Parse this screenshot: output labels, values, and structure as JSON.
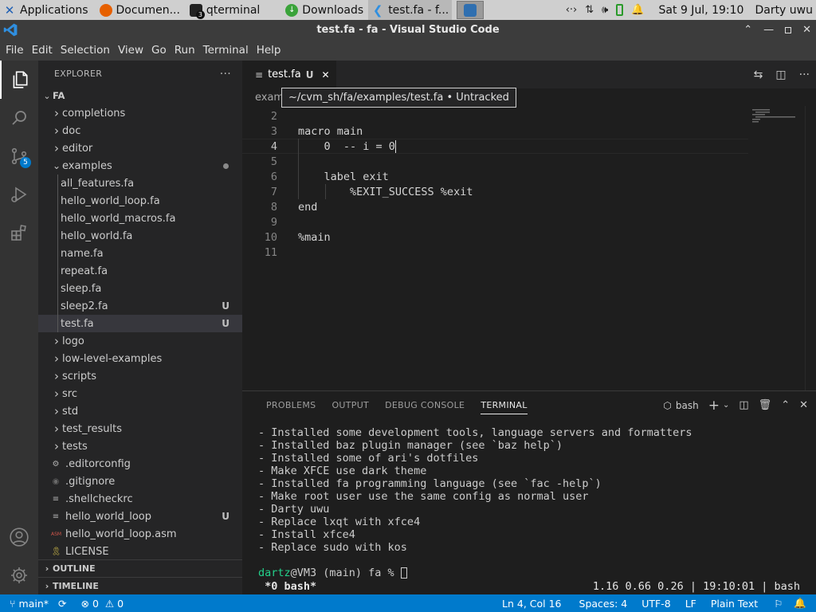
{
  "system_panel": {
    "tasks": [
      {
        "label": "Applications",
        "icon": "xfce-icon"
      },
      {
        "label": "Documen...",
        "icon": "firefox-icon"
      },
      {
        "label": "qterminal",
        "icon": "terminal-icon",
        "badge": "3"
      },
      {
        "label": "Downloads",
        "icon": "downloads-icon"
      },
      {
        "label": "test.fa - f...",
        "icon": "vscode-icon"
      }
    ],
    "clock": "Sat  9 Jul, 19:10",
    "user": "Darty uwu"
  },
  "window": {
    "title": "test.fa - fa - Visual Studio Code"
  },
  "menu": [
    "File",
    "Edit",
    "Selection",
    "View",
    "Go",
    "Run",
    "Terminal",
    "Help"
  ],
  "activity_bar": {
    "scm_badge": "5"
  },
  "explorer": {
    "header": "EXPLORER",
    "more": "···",
    "root": "FA",
    "items": [
      {
        "label": "completions",
        "kind": "folder",
        "indent": 1,
        "open": false
      },
      {
        "label": "doc",
        "kind": "folder",
        "indent": 1,
        "open": false
      },
      {
        "label": "editor",
        "kind": "folder",
        "indent": 1,
        "open": false
      },
      {
        "label": "examples",
        "kind": "folder",
        "indent": 1,
        "open": true,
        "dot": true
      },
      {
        "label": "all_features.fa",
        "kind": "file",
        "indent": 2
      },
      {
        "label": "hello_world_loop.fa",
        "kind": "file",
        "indent": 2
      },
      {
        "label": "hello_world_macros.fa",
        "kind": "file",
        "indent": 2
      },
      {
        "label": "hello_world.fa",
        "kind": "file",
        "indent": 2
      },
      {
        "label": "name.fa",
        "kind": "file",
        "indent": 2
      },
      {
        "label": "repeat.fa",
        "kind": "file",
        "indent": 2
      },
      {
        "label": "sleep.fa",
        "kind": "file",
        "indent": 2
      },
      {
        "label": "sleep2.fa",
        "kind": "file",
        "indent": 2,
        "status": "U"
      },
      {
        "label": "test.fa",
        "kind": "file",
        "indent": 2,
        "status": "U",
        "selected": true
      },
      {
        "label": "logo",
        "kind": "folder",
        "indent": 1,
        "open": false
      },
      {
        "label": "low-level-examples",
        "kind": "folder",
        "indent": 1,
        "open": false
      },
      {
        "label": "scripts",
        "kind": "folder",
        "indent": 1,
        "open": false
      },
      {
        "label": "src",
        "kind": "folder",
        "indent": 1,
        "open": false
      },
      {
        "label": "std",
        "kind": "folder",
        "indent": 1,
        "open": false
      },
      {
        "label": "test_results",
        "kind": "folder",
        "indent": 1,
        "open": false
      },
      {
        "label": "tests",
        "kind": "folder",
        "indent": 1,
        "open": false
      },
      {
        "label": ".editorconfig",
        "kind": "file",
        "indent": 1,
        "icon": "gear"
      },
      {
        "label": ".gitignore",
        "kind": "file",
        "indent": 1,
        "icon": "git"
      },
      {
        "label": ".shellcheckrc",
        "kind": "file",
        "indent": 1,
        "icon": "eq"
      },
      {
        "label": "hello_world_loop",
        "kind": "file",
        "indent": 1,
        "icon": "eq",
        "status": "U"
      },
      {
        "label": "hello_world_loop.asm",
        "kind": "file",
        "indent": 1,
        "icon": "asm"
      },
      {
        "label": "LICENSE",
        "kind": "file",
        "indent": 1,
        "icon": "license"
      }
    ],
    "outline": "OUTLINE",
    "timeline": "TIMELINE"
  },
  "editor": {
    "tab": {
      "label": "test.fa",
      "status": "U"
    },
    "breadcrumb": "exam",
    "tooltip": "~/cvm_sh/fa/examples/test.fa • Untracked",
    "lines": [
      {
        "n": "2",
        "text": ""
      },
      {
        "n": "3",
        "text": "macro main"
      },
      {
        "n": "4",
        "text": "    0  -- i = 0",
        "current": true
      },
      {
        "n": "5",
        "text": ""
      },
      {
        "n": "6",
        "text": "    label exit"
      },
      {
        "n": "7",
        "text": "        %EXIT_SUCCESS %exit"
      },
      {
        "n": "8",
        "text": "end"
      },
      {
        "n": "9",
        "text": ""
      },
      {
        "n": "10",
        "text": "%main"
      },
      {
        "n": "11",
        "text": ""
      }
    ]
  },
  "panel": {
    "tabs": [
      "PROBLEMS",
      "OUTPUT",
      "DEBUG CONSOLE",
      "TERMINAL"
    ],
    "active_tab": "TERMINAL",
    "shell": "bash",
    "terminal_lines": [
      "- Installed some development tools, language servers and formatters",
      "- Installed baz plugin manager (see `baz help`)",
      "- Installed some of ari's dotfiles",
      "- Make XFCE use dark theme",
      "- Installed fa programming language (see `fac -help`)",
      "- Make root user use the same config as normal user",
      "- Darty uwu",
      "- Replace lxqt with xfce4",
      "- Install xfce4",
      "- Replace sudo with kos"
    ],
    "prompt_user": "dartz",
    "prompt_rest": "@VM3 (main) fa % ",
    "tmux_left": " *0 bash*",
    "tmux_right": "1.16 0.66 0.26 | 19:10:01 | bash"
  },
  "statusbar": {
    "branch": "main*",
    "errors": "0",
    "warnings": "0",
    "position": "Ln 4, Col 16",
    "spaces": "Spaces: 4",
    "encoding": "UTF-8",
    "eol": "LF",
    "language": "Plain Text"
  },
  "colors": {
    "accent": "#007acc",
    "activity_bg": "#333333",
    "sidebar_bg": "#252526",
    "editor_bg": "#1e1e1e",
    "prompt_user": "#23d18b"
  }
}
